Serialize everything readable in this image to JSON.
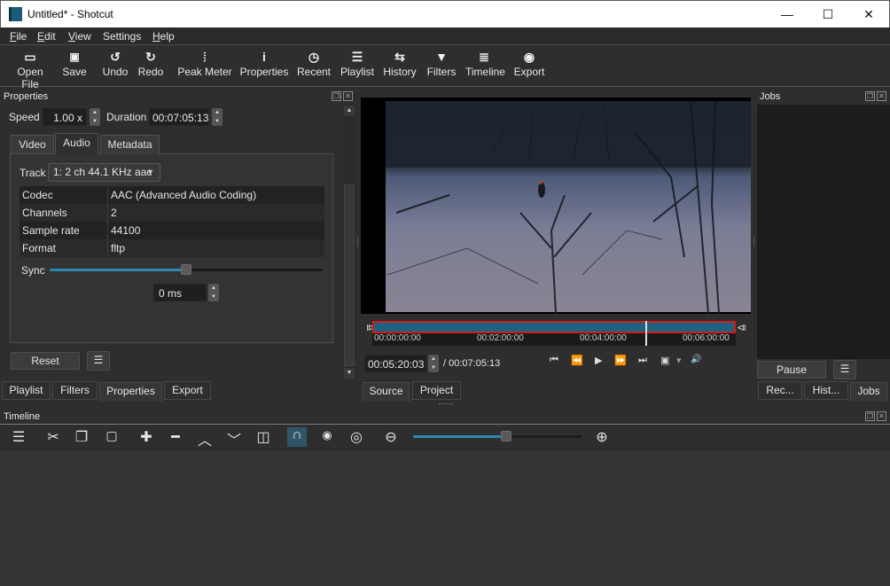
{
  "window": {
    "title": "Untitled* - Shotcut",
    "controls": {
      "minimize": "—",
      "maximize": "☐",
      "close": "✕"
    }
  },
  "menu": [
    {
      "label": "File",
      "mnemonic": "F",
      "rest": "ile"
    },
    {
      "label": "Edit",
      "mnemonic": "E",
      "rest": "dit"
    },
    {
      "label": "View",
      "mnemonic": "V",
      "rest": "iew"
    },
    {
      "label": "Settings",
      "mnemonic": "",
      "rest": "Settings"
    },
    {
      "label": "Help",
      "mnemonic": "H",
      "rest": "elp"
    }
  ],
  "toolbar": [
    {
      "label": "Open File",
      "icon": "folder-icon",
      "glyph": "▭"
    },
    {
      "label": "Save",
      "icon": "save-icon",
      "glyph": "💾"
    },
    {
      "label": "Undo",
      "icon": "undo-icon",
      "glyph": "↺"
    },
    {
      "label": "Redo",
      "icon": "redo-icon",
      "glyph": "↻"
    },
    {
      "label": "Peak Meter",
      "icon": "peak-meter-icon",
      "glyph": "⦙"
    },
    {
      "label": "Properties",
      "icon": "info-icon",
      "glyph": "i"
    },
    {
      "label": "Recent",
      "icon": "clock-icon",
      "glyph": "◷"
    },
    {
      "label": "Playlist",
      "icon": "list-icon",
      "glyph": "☰"
    },
    {
      "label": "History",
      "icon": "history-icon",
      "glyph": "⇆"
    },
    {
      "label": "Filters",
      "icon": "filter-icon",
      "glyph": "▼"
    },
    {
      "label": "Timeline",
      "icon": "timeline-icon",
      "glyph": "≣"
    },
    {
      "label": "Export",
      "icon": "disc-icon",
      "glyph": "◉"
    }
  ],
  "properties": {
    "title": "Properties",
    "speed_label": "Speed",
    "speed_value": "1.00 x",
    "duration_label": "Duration",
    "duration_value": "00:07:05:13",
    "tabs": [
      "Video",
      "Audio",
      "Metadata"
    ],
    "active_tab": "Audio",
    "track_label": "Track",
    "track_value": "1: 2 ch 44.1 KHz aac",
    "info_rows": [
      {
        "key": "Codec",
        "value": "AAC (Advanced Audio Coding)"
      },
      {
        "key": "Channels",
        "value": "2"
      },
      {
        "key": "Sample rate",
        "value": "44100"
      },
      {
        "key": "Format",
        "value": "fltp"
      }
    ],
    "sync_label": "Sync",
    "sync_slider_fraction": 0.5,
    "sync_value": "0 ms",
    "reset_label": "Reset",
    "menu_glyph": "☰"
  },
  "left_tabs": [
    "Playlist",
    "Filters",
    "Properties",
    "Export"
  ],
  "left_active_tab": "Properties",
  "player": {
    "ruler_ticks": [
      "00:00:00:00",
      "00:02:00:00",
      "00:04:00:00",
      "00:06:00:00"
    ],
    "playhead_fraction": 0.752,
    "position": "00:05:20:03",
    "duration": "/ 00:07:05:13",
    "transport": [
      {
        "name": "skip-to-start-icon",
        "glyph": "⏮"
      },
      {
        "name": "rewind-icon",
        "glyph": "⏪"
      },
      {
        "name": "play-icon",
        "glyph": "▶"
      },
      {
        "name": "fast-forward-icon",
        "glyph": "⏩"
      },
      {
        "name": "skip-to-end-icon",
        "glyph": "⏭"
      },
      {
        "name": "zoom-fit-icon",
        "glyph": "▣"
      },
      {
        "name": "dropdown-arrow-icon",
        "glyph": "▾"
      },
      {
        "name": "volume-icon",
        "glyph": "🔊"
      }
    ],
    "tabs": [
      "Source",
      "Project"
    ],
    "active_tab": "Source"
  },
  "jobs": {
    "title": "Jobs",
    "pause_label": "Pause",
    "menu_glyph": "☰",
    "tabs": [
      "Rec...",
      "Hist...",
      "Jobs"
    ],
    "active_tab": "Jobs"
  },
  "timeline": {
    "title": "Timeline",
    "tools": [
      {
        "name": "menu-icon",
        "glyph": "☰"
      },
      {
        "name": "cut-icon",
        "glyph": "✂"
      },
      {
        "name": "copy-icon",
        "glyph": "❐"
      },
      {
        "name": "paste-icon",
        "glyph": "📋"
      },
      {
        "name": "append-icon",
        "glyph": "✚"
      },
      {
        "name": "remove-icon",
        "glyph": "━"
      },
      {
        "name": "lift-icon",
        "glyph": "︿"
      },
      {
        "name": "overwrite-icon",
        "glyph": "﹀"
      },
      {
        "name": "split-icon",
        "glyph": "◫"
      },
      {
        "name": "snap-icon",
        "glyph": "∩"
      },
      {
        "name": "scrub-icon",
        "glyph": "👁"
      },
      {
        "name": "ripple-icon",
        "glyph": "◎"
      },
      {
        "name": "zoom-out-icon",
        "glyph": "⊖"
      },
      {
        "name": "zoom-in-icon",
        "glyph": "⊕"
      }
    ],
    "zoom_slider_fraction": 0.55
  },
  "colors": {
    "accent": "#2d88b0",
    "in_out_bar": "#1e6282",
    "in_out_border": "#d81a1a"
  }
}
